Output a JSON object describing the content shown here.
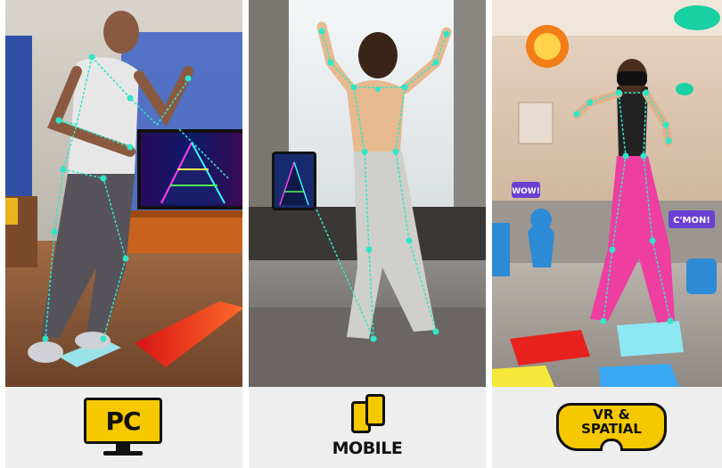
{
  "panels": {
    "pc": {
      "label": "PC",
      "icon": "monitor-icon"
    },
    "mobile": {
      "label": "MOBILE",
      "icon": "phones-icon"
    },
    "vr": {
      "label_line1": "VR &",
      "label_line2": "SPATIAL",
      "icon": "vr-headset-icon"
    }
  },
  "stickers": {
    "wow": "WOW!",
    "cmon": "C'MON!"
  },
  "colors": {
    "accent_yellow": "#f5c800",
    "footer_gray": "#eeeeee",
    "tracking_teal": "#2fe6c8",
    "pad_red": "#e8231f",
    "pad_cyan": "#8de8f2",
    "pants_pink": "#ee3ea0"
  }
}
